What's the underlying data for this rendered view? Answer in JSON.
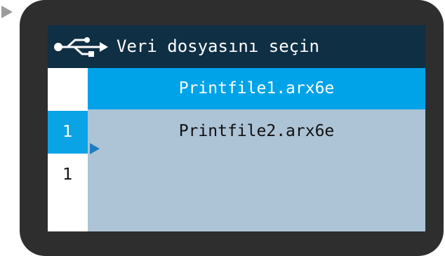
{
  "header": {
    "title": "Veri dosyasını seçin",
    "icon": "usb-icon"
  },
  "files": [
    {
      "name": "Printfile1.arx6e",
      "selected": true
    },
    {
      "name": "Printfile2.arx6e",
      "selected": false
    }
  ],
  "counters": [
    {
      "value": "",
      "active": false
    },
    {
      "value": "1",
      "active": true
    },
    {
      "value": "1",
      "active": false
    }
  ],
  "colors": {
    "device_bezel": "#2e2e2e",
    "titlebar": "#0f2f45",
    "selection": "#00a3e7",
    "list_background": "#adc3d6",
    "marker": "#1d7fc1"
  }
}
